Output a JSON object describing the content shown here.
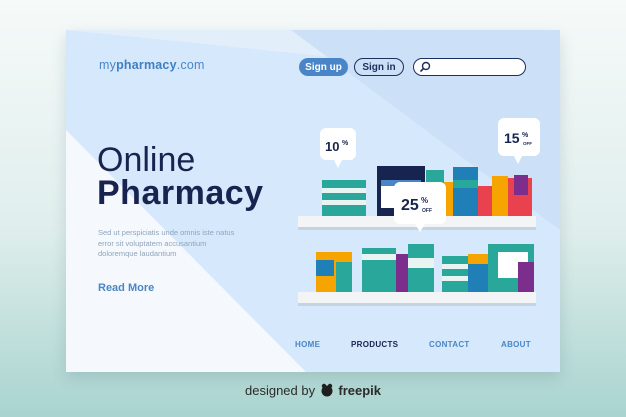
{
  "brand": {
    "prefix": "my",
    "name": "pharmacy",
    "suffix": ".com"
  },
  "header": {
    "signup_label": "Sign up",
    "signin_label": "Sign in",
    "search_placeholder": ""
  },
  "hero": {
    "title_line1": "Online",
    "title_line2": "Pharmacy",
    "body": "Sed ut perspiciatis unde omnis iste natus error sit voluptatem accusantium doloremque laudantium",
    "cta_label": "Read More"
  },
  "badges": [
    {
      "percent": "10",
      "suffix": "%",
      "label": "OFF"
    },
    {
      "percent": "25",
      "suffix": "%",
      "label": "OFF"
    },
    {
      "percent": "15",
      "suffix": "%",
      "label": "OFF"
    }
  ],
  "nav": [
    "HOME",
    "PRODUCTS",
    "CONTACT",
    "ABOUT"
  ],
  "footer_credit": {
    "prefix": "designed by",
    "brand": "freepik"
  },
  "colors": {
    "accent": "#4a86c7",
    "navy": "#17244f",
    "card_bg": "#d6e8fb",
    "shelf": "#f2f4f6"
  },
  "icons": [
    "search-icon",
    "freepik-logo-icon"
  ]
}
